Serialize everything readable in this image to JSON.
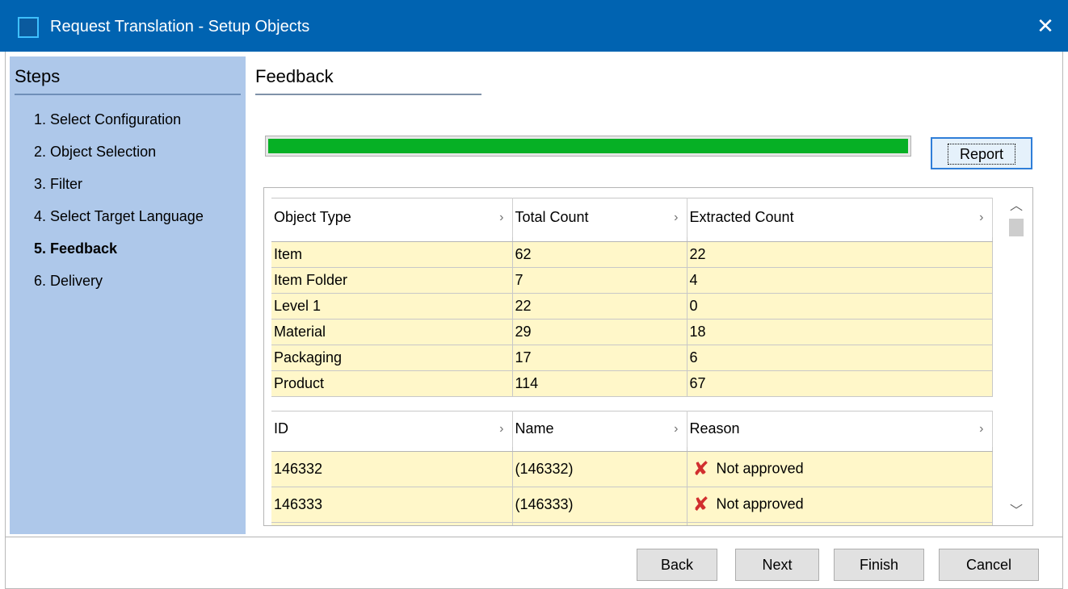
{
  "window": {
    "title": "Request Translation - Setup Objects",
    "close_label": "✕",
    "icon": "window-app-icon"
  },
  "steps": {
    "title": "Steps",
    "items": [
      {
        "label": "1. Select Configuration",
        "active": false
      },
      {
        "label": "2. Object Selection",
        "active": false
      },
      {
        "label": "3. Filter",
        "active": false
      },
      {
        "label": "4. Select Target Language",
        "active": false
      },
      {
        "label": "5. Feedback",
        "active": true
      },
      {
        "label": "6. Delivery",
        "active": false
      }
    ]
  },
  "main": {
    "title": "Feedback",
    "progress": 1.0,
    "report_label": "Report"
  },
  "counts_table": {
    "headers": [
      "Object Type",
      "Total Count",
      "Extracted Count"
    ],
    "rows": [
      [
        "Item",
        "62",
        "22"
      ],
      [
        "Item Folder",
        "7",
        "4"
      ],
      [
        "Level 1",
        "22",
        "0"
      ],
      [
        "Material",
        "29",
        "18"
      ],
      [
        "Packaging",
        "17",
        "6"
      ],
      [
        "Product",
        "114",
        "67"
      ]
    ]
  },
  "details_table": {
    "headers": [
      "ID",
      "Name",
      "Reason"
    ],
    "rows": [
      [
        "146332",
        "(146332)",
        "Not approved"
      ],
      [
        "146333",
        "(146333)",
        "Not approved"
      ]
    ]
  },
  "footer": {
    "back_label": "Back",
    "next_label": "Next",
    "finish_label": "Finish",
    "cancel_label": "Cancel"
  },
  "colors": {
    "titlebar": "#0063b1",
    "steps_panel": "#aec8ea",
    "progress_fill": "#06b025",
    "row_fill": "#fff7c9",
    "error_icon": "#d12f2f"
  }
}
